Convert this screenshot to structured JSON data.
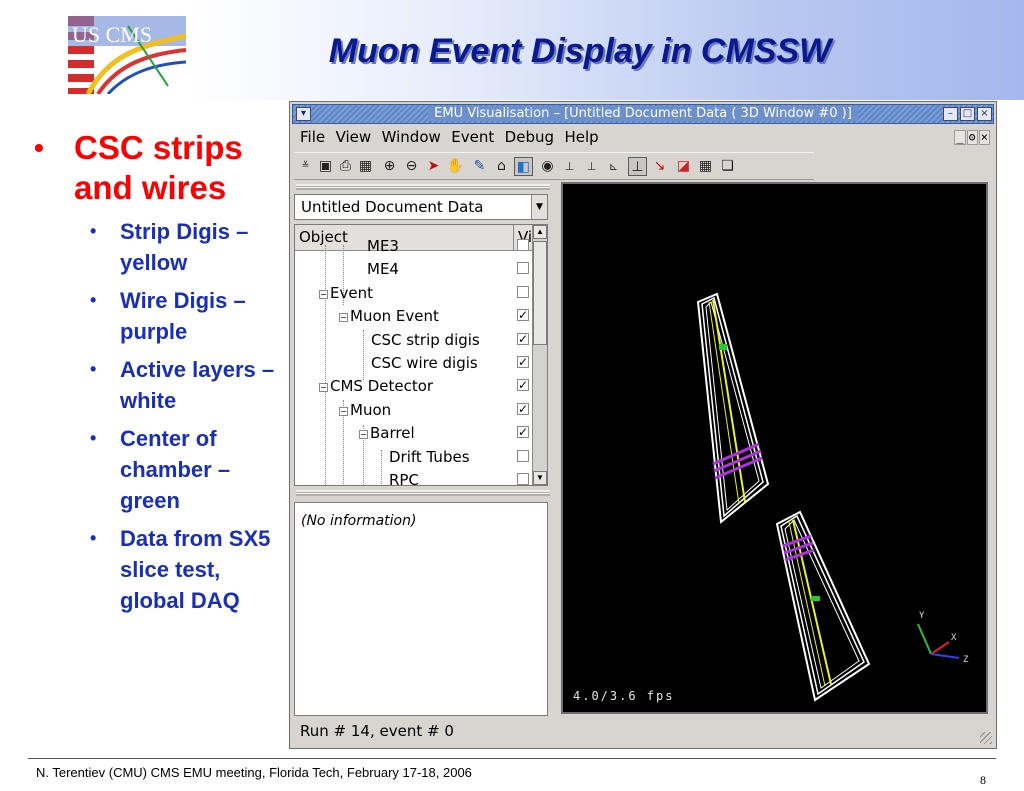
{
  "slide": {
    "title": "Muon Event Display in CMSSW",
    "logo_text": "US CMS",
    "bullet_main": "CSC strips and wires",
    "sub_bullets": [
      "Strip Digis – yellow",
      "Wire Digis – purple",
      "Active layers – white",
      "Center of chamber – green",
      "Data from SX5 slice test, global DAQ"
    ],
    "footer": "N. Terentiev  (CMU)    CMS EMU meeting,  Florida Tech,   February 17-18,  2006",
    "page_number": "8"
  },
  "window": {
    "title": "EMU Visualisation – [Untitled Document Data ( 3D Window #0 )]",
    "menu": [
      {
        "label": "File",
        "accel": "F"
      },
      {
        "label": "View",
        "accel": "V"
      },
      {
        "label": "Window",
        "accel": "W"
      },
      {
        "label": "Event",
        "accel": "E"
      },
      {
        "label": "Debug",
        "accel": "D"
      },
      {
        "label": "Help",
        "accel": "H"
      }
    ],
    "document_combo": "Untitled Document Data",
    "tree_header": {
      "object": "Object",
      "visible": "Vi"
    },
    "tree_rows": [
      {
        "label": "ME3",
        "checked": false
      },
      {
        "label": "ME4",
        "checked": false
      },
      {
        "label": "Event",
        "checked": false
      },
      {
        "label": "Muon Event",
        "checked": true
      },
      {
        "label": "CSC strip digis",
        "checked": true
      },
      {
        "label": "CSC wire digis",
        "checked": true
      },
      {
        "label": "CMS Detector",
        "checked": true
      },
      {
        "label": "Muon",
        "checked": true
      },
      {
        "label": "Barrel",
        "checked": true
      },
      {
        "label": "Drift Tubes",
        "checked": false
      },
      {
        "label": "RPC",
        "checked": false
      }
    ],
    "info_text": "(No information)",
    "fps_text": "4.0/3.6 fps",
    "status_text": "Run # 14, event # 0",
    "axes": {
      "x": "X",
      "y": "Y",
      "z": "Z"
    },
    "colors": {
      "strip": "#e8f030",
      "wire": "#b030e8",
      "layers": "#ffffff",
      "center": "#20d020"
    }
  }
}
